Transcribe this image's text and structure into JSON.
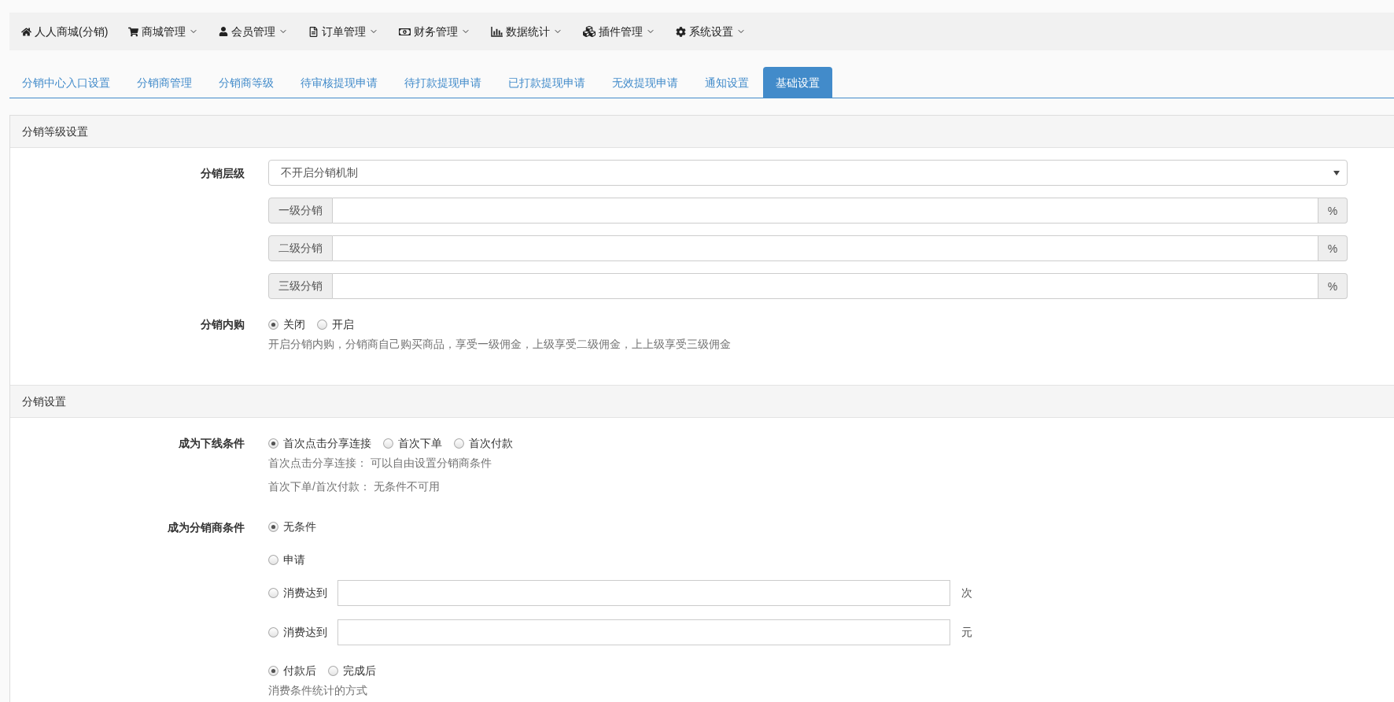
{
  "navbar": {
    "brand": "人人商城(分销)",
    "menus": [
      "商城管理",
      "会员管理",
      "订单管理",
      "财务管理",
      "数据统计",
      "插件管理",
      "系统设置"
    ]
  },
  "tabs": [
    {
      "label": "分销中心入口设置",
      "selected": false
    },
    {
      "label": "分销商管理",
      "selected": false
    },
    {
      "label": "分销商等级",
      "selected": false
    },
    {
      "label": "待审核提现申请",
      "selected": false
    },
    {
      "label": "待打款提现申请",
      "selected": false
    },
    {
      "label": "已打款提现申请",
      "selected": false
    },
    {
      "label": "无效提现申请",
      "selected": false
    },
    {
      "label": "通知设置",
      "selected": false
    },
    {
      "label": "基础设置",
      "selected": true
    }
  ],
  "sections": [
    {
      "heading": "分销等级设置",
      "rows": [
        {
          "kind": "select",
          "label": "分销层级",
          "value": "不开启分销机制"
        },
        {
          "kind": "addon_input",
          "prefix": "一级分销",
          "suffix": "%"
        },
        {
          "kind": "addon_input",
          "prefix": "二级分销",
          "suffix": "%"
        },
        {
          "kind": "addon_input",
          "prefix": "三级分销",
          "suffix": "%"
        },
        {
          "kind": "radios",
          "label": "分销内购",
          "options": [
            {
              "label": "关闭",
              "selected": true
            },
            {
              "label": "开启",
              "selected": false
            }
          ],
          "help": [
            "开启分销内购，分销商自己购买商品，享受一级佣金，上级享受二级佣金，上上级享受三级佣金"
          ]
        }
      ]
    },
    {
      "heading": "分销设置",
      "rows": [
        {
          "kind": "radios",
          "label": "成为下线条件",
          "options": [
            {
              "label": "首次点击分享连接",
              "selected": true
            },
            {
              "label": "首次下单",
              "selected": false
            },
            {
              "label": "首次付款",
              "selected": false
            }
          ],
          "help": [
            "首次点击分享连接： 可以自由设置分销商条件",
            "首次下单/首次付款： 无条件不可用"
          ]
        },
        {
          "kind": "choice_list",
          "label": "成为分销商条件",
          "options": [
            {
              "label": "无条件",
              "selected": true
            },
            {
              "label": "申请",
              "selected": false
            },
            {
              "label": "消费达到",
              "selected": false,
              "unit": "次"
            },
            {
              "label": "消费达到",
              "selected": false,
              "unit": "元"
            }
          ]
        },
        {
          "kind": "radios",
          "options": [
            {
              "label": "付款后",
              "selected": true
            },
            {
              "label": "完成后",
              "selected": false
            }
          ],
          "help": [
            "消费条件统计的方式"
          ]
        }
      ]
    }
  ]
}
